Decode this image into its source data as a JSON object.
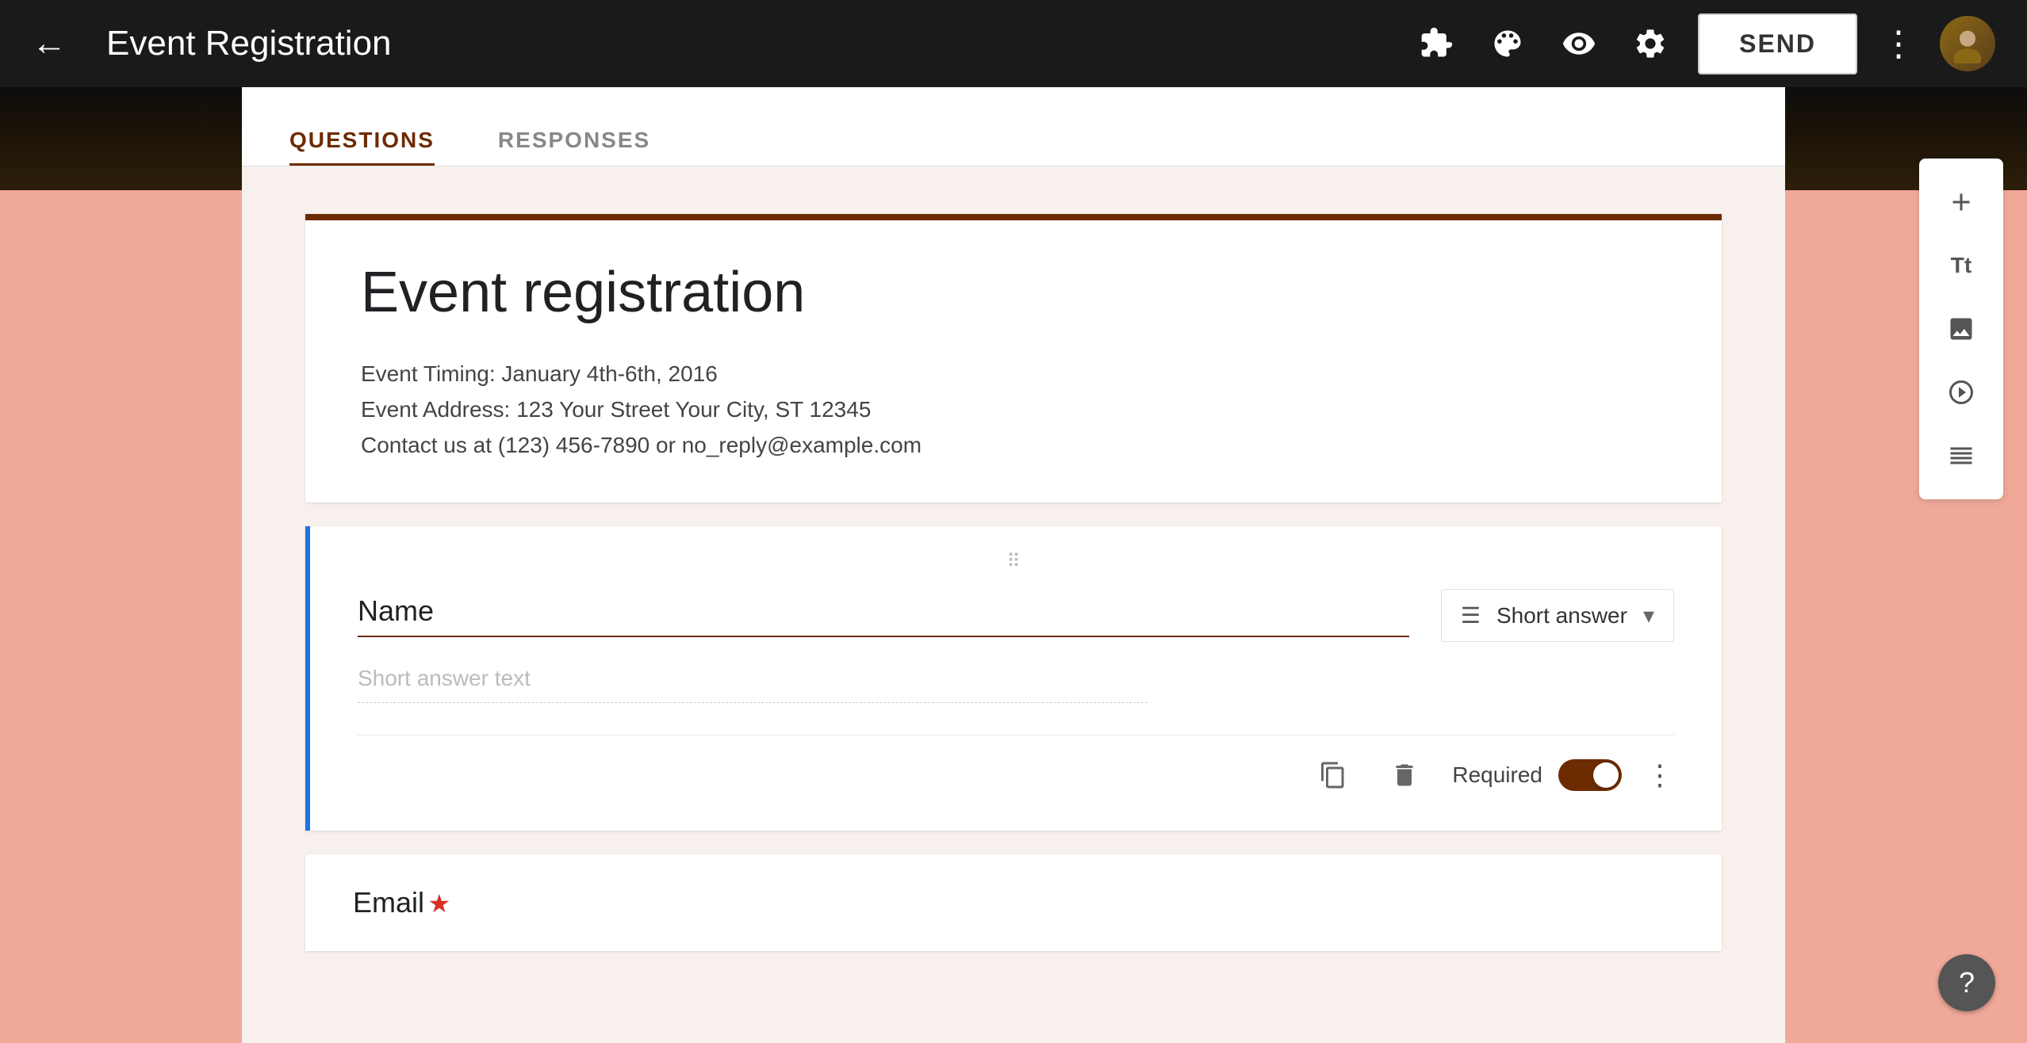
{
  "header": {
    "title": "Event Registration",
    "back_label": "←",
    "send_label": "SEND",
    "icons": {
      "extensions": "🧩",
      "palette": "🎨",
      "preview": "👁",
      "settings": "⚙"
    }
  },
  "tabs": [
    {
      "label": "QUESTIONS",
      "active": true
    },
    {
      "label": "RESPONSES",
      "active": false
    }
  ],
  "form": {
    "title": "Event registration",
    "description_line1": "Event Timing: January 4th-6th, 2016",
    "description_line2": "Event Address: 123 Your Street Your City, ST 12345",
    "description_line3": "Contact us at (123) 456-7890 or no_reply@example.com"
  },
  "questions": [
    {
      "id": "q1",
      "label": "Name",
      "type": "Short answer",
      "placeholder": "Short answer text",
      "required": true,
      "required_toggle": true
    },
    {
      "id": "q2",
      "label": "Email",
      "required": true
    }
  ],
  "sidebar_tools": [
    {
      "name": "add",
      "icon": "+"
    },
    {
      "name": "text",
      "icon": "Tt"
    },
    {
      "name": "image",
      "icon": "🖼"
    },
    {
      "name": "video",
      "icon": "▶"
    },
    {
      "name": "section",
      "icon": "☰"
    }
  ],
  "help": {
    "label": "?"
  }
}
